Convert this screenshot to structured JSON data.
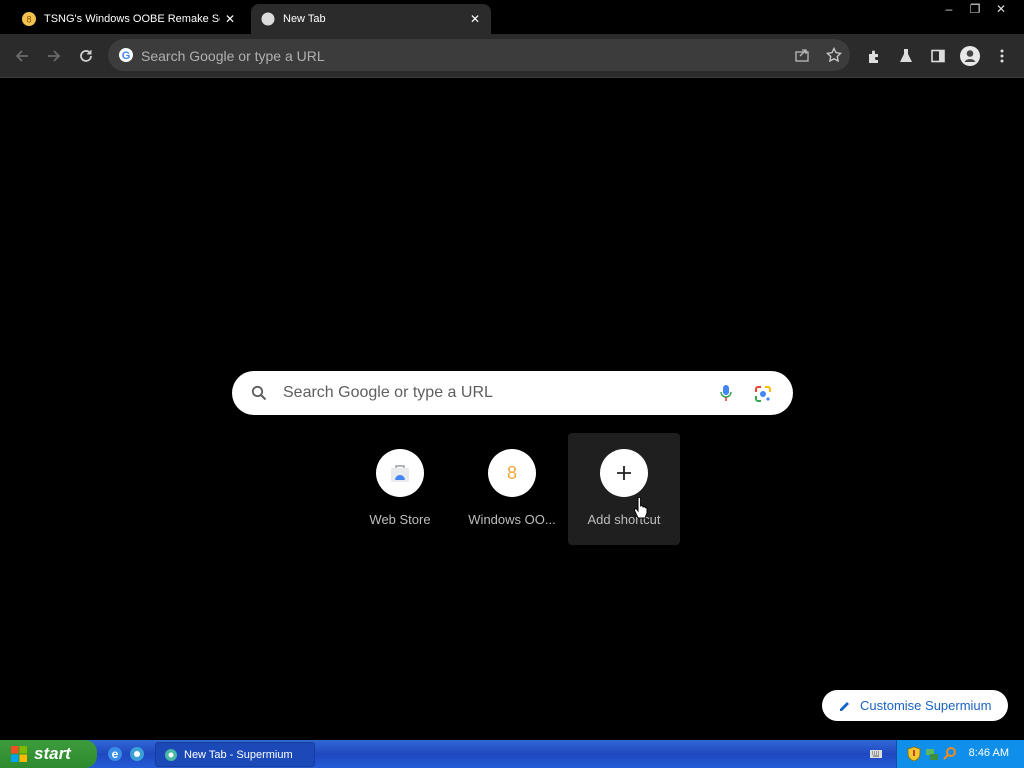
{
  "tabs": [
    {
      "title": "TSNG's Windows OOBE Remake Setup"
    },
    {
      "title": "New Tab"
    }
  ],
  "window_controls": {
    "minimize": "–",
    "restore": "❐",
    "close": "✕"
  },
  "omnibox": {
    "placeholder": "Search Google or type a URL"
  },
  "ntp": {
    "search_placeholder": "Search Google or type a URL",
    "shortcuts": [
      {
        "label": "Web Store",
        "icon": "web-store-icon"
      },
      {
        "label": "Windows OO...",
        "icon": "oobe-icon"
      },
      {
        "label": "Add shortcut",
        "icon": "plus-icon"
      }
    ],
    "customise_label": "Customise Supermium"
  },
  "taskbar": {
    "start_label": "start",
    "task_item_label": "New Tab - Supermium",
    "clock": "8:46 AM"
  },
  "colors": {
    "accent": "#1a62c3",
    "xp_taskbar": "#245cd8",
    "start_green": "#3c9c3c"
  }
}
